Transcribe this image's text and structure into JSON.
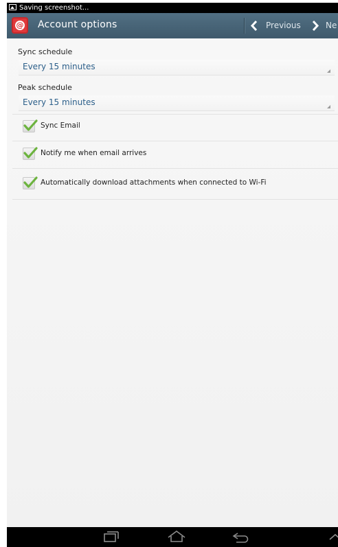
{
  "status_bar": {
    "text": "Saving screenshot..."
  },
  "action_bar": {
    "title": "Account options",
    "previous_label": "Previous",
    "next_label": "Ne"
  },
  "sync_schedule": {
    "label": "Sync schedule",
    "value": "Every 15 minutes"
  },
  "peak_schedule": {
    "label": "Peak schedule",
    "value": "Every 15 minutes"
  },
  "options": [
    {
      "label": "Sync Email",
      "checked": true
    },
    {
      "label": "Notify me when email arrives",
      "checked": true
    },
    {
      "label": "Automatically download attachments when connected to Wi-Fi",
      "checked": true
    }
  ],
  "colors": {
    "action_bar": "#475f71",
    "link_blue": "#2c5f8a",
    "check_green": "#6cb33e",
    "app_icon_red": "#e0393b"
  },
  "nav_bar": [
    "recent-apps-icon",
    "home-icon",
    "back-icon",
    "up-chevron-icon"
  ]
}
